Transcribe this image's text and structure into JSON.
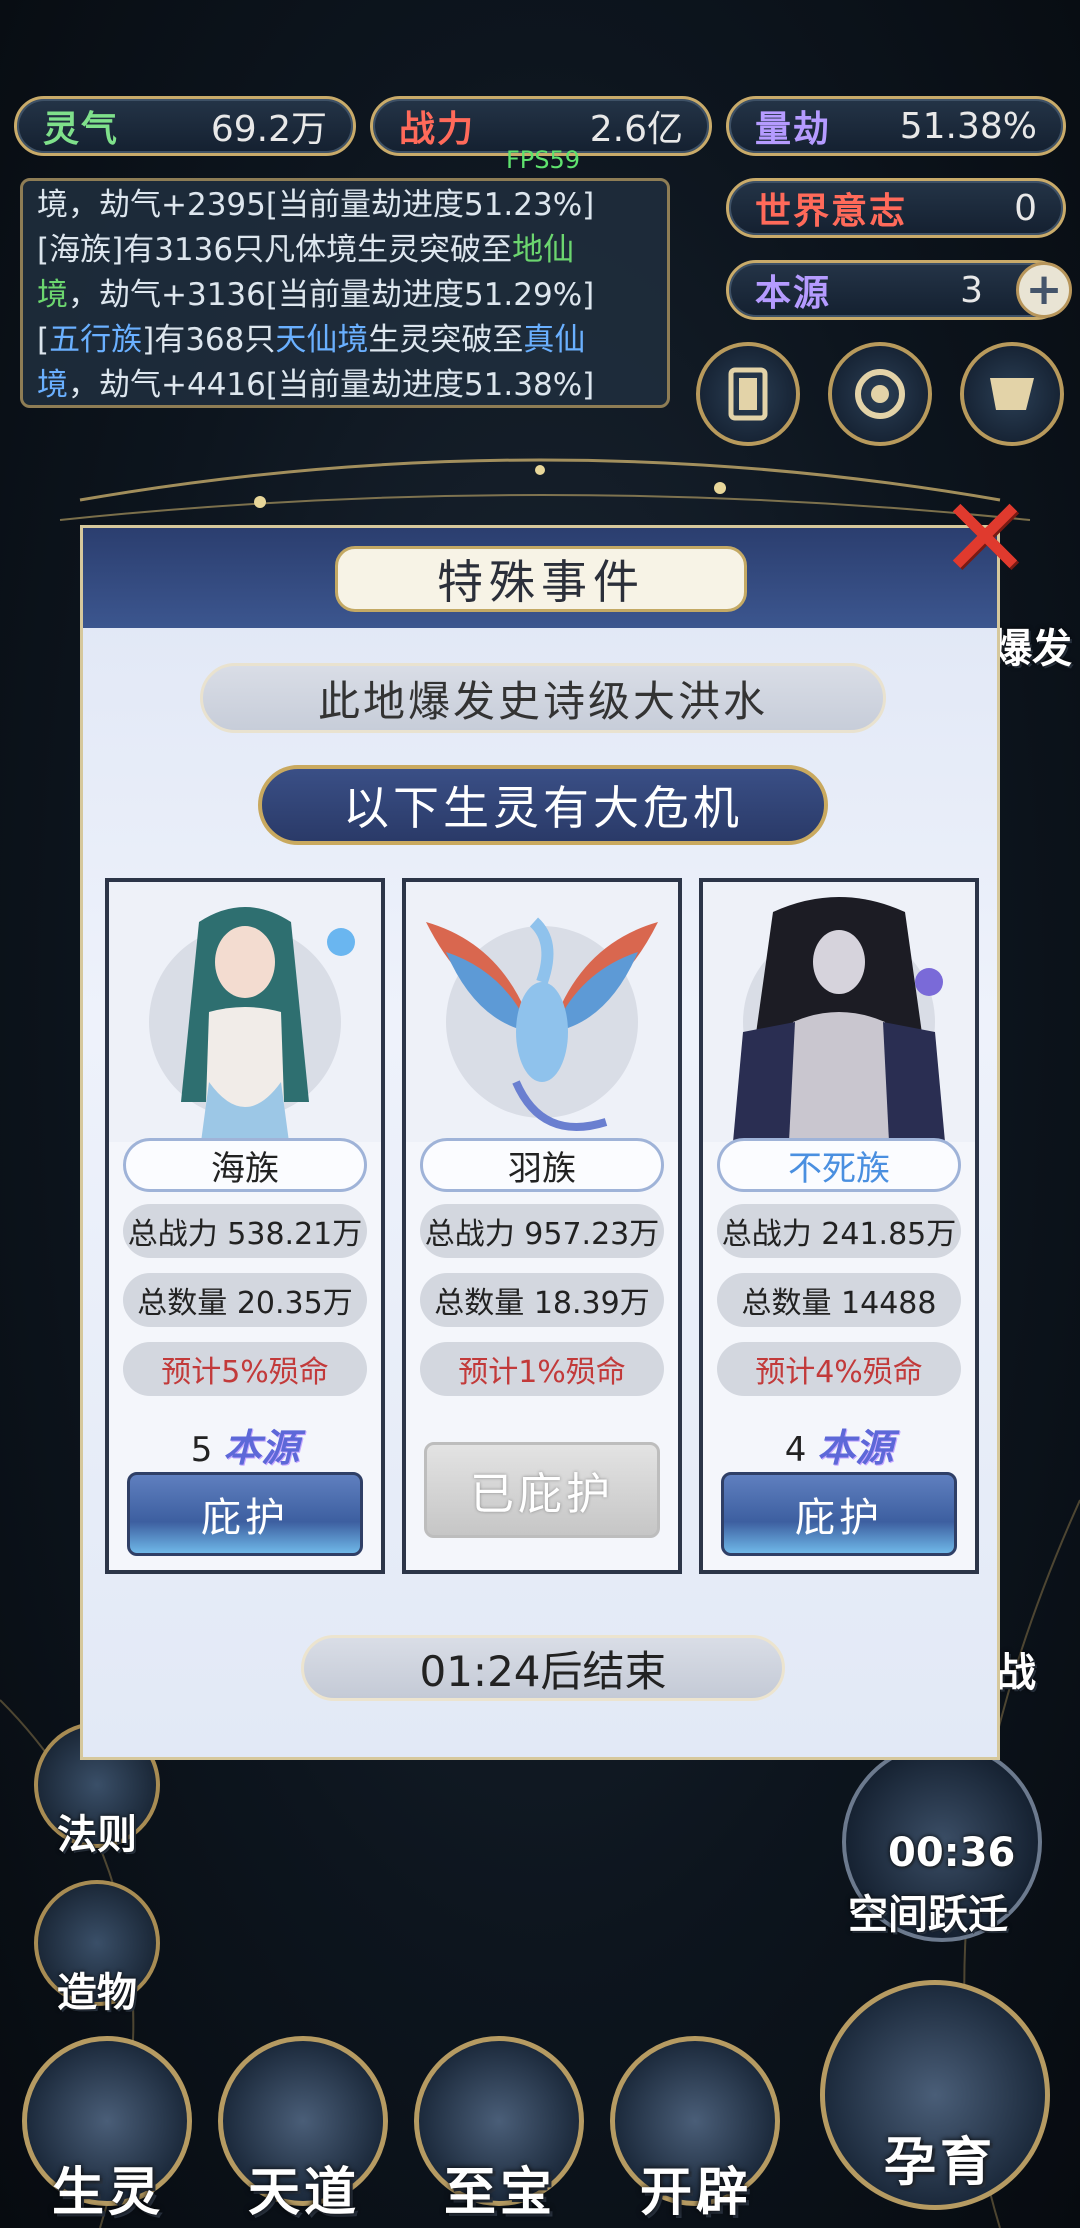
{
  "stats": {
    "lingqi": {
      "label": "灵气",
      "value": "69.2万"
    },
    "zhanli": {
      "label": "战力",
      "value": "2.6亿"
    },
    "liangjie": {
      "label": "量劫",
      "value": "51.38%"
    },
    "world_will": {
      "label": "世界意志",
      "value": "0"
    },
    "origin": {
      "label": "本源",
      "value": "3"
    }
  },
  "fps": "FPS59",
  "log": {
    "line1_a": "境，劫气+2395[当前量劫进度51.23%]",
    "line2_a": "[海族]有3136只凡体境生灵突破至",
    "line2_b": "地仙",
    "line3_a": "境",
    "line3_b": "，劫气+3136[当前量劫进度51.29%]",
    "line4_a": "[",
    "line4_b": "五行族",
    "line4_c": "]有368只",
    "line4_d": "天仙境",
    "line4_e": "生灵突破至",
    "line4_f": "真仙",
    "line5_a": "境",
    "line5_b": "，劫气+4416[当前量劫进度51.38%]"
  },
  "side_menu": [
    {
      "label": "法则"
    },
    {
      "label": "造物"
    }
  ],
  "bottom_menu": [
    {
      "label": "生灵"
    },
    {
      "label": "天道"
    },
    {
      "label": "至宝"
    },
    {
      "label": "开辟"
    },
    {
      "label": "孕育"
    }
  ],
  "right_items": {
    "burst_label": "爆发",
    "war_label": "战",
    "jump_timer": "00:36",
    "jump_label": "空间跃迁"
  },
  "modal": {
    "title": "特殊事件",
    "event": "此地爆发史诗级大洪水",
    "danger": "以下生灵有大危机",
    "cards": [
      {
        "race": "海族",
        "power": "总战力 538.21万",
        "count": "总数量 20.35万",
        "death": "预计5%殒命",
        "cost_num": "5",
        "cost_label": "本源",
        "button": "庇护"
      },
      {
        "race": "羽族",
        "power": "总战力 957.23万",
        "count": "总数量 18.39万",
        "death": "预计1%殒命",
        "button": "已庇护"
      },
      {
        "race": "不死族",
        "power": "总战力 241.85万",
        "count": "总数量 14488",
        "death": "预计4%殒命",
        "cost_num": "4",
        "cost_label": "本源",
        "button": "庇护"
      }
    ],
    "timer": "01:24后结束",
    "close_icon": "close-x-icon"
  },
  "colors": {
    "gold": "#c9ab6a",
    "green": "#6cd66f",
    "blue": "#6ab0ff",
    "red_text": "#c23a3a"
  }
}
